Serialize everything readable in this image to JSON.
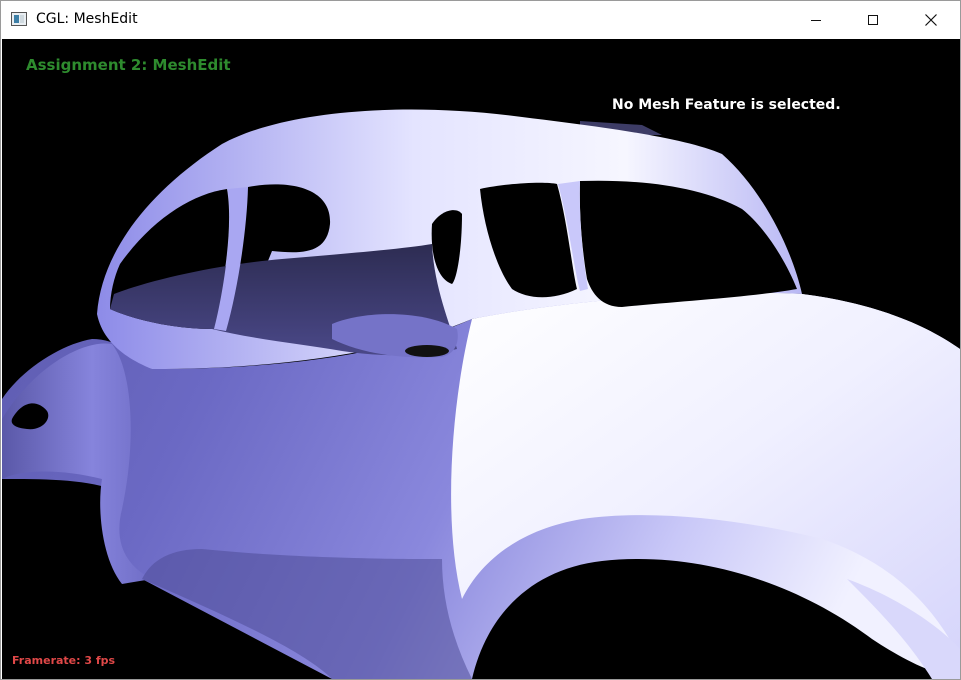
{
  "window": {
    "title": "CGL: MeshEdit",
    "icon": "app-window-icon",
    "controls": [
      "minimize-icon",
      "maximize-icon",
      "close-icon"
    ]
  },
  "overlay": {
    "assignment_title": "Assignment 2: MeshEdit",
    "selection_status": "No Mesh Feature is selected.",
    "framerate": "Framerate: 3 fps"
  },
  "colors": {
    "title_text": "#2e8b2e",
    "status_text": "#ffffff",
    "framerate_text": "#e04848",
    "background": "#000000",
    "mesh_light": "#f4f4ff",
    "mesh_mid": "#9e9cf2",
    "mesh_dark": "#4f4d99"
  },
  "scene": {
    "model": "car body mesh"
  }
}
